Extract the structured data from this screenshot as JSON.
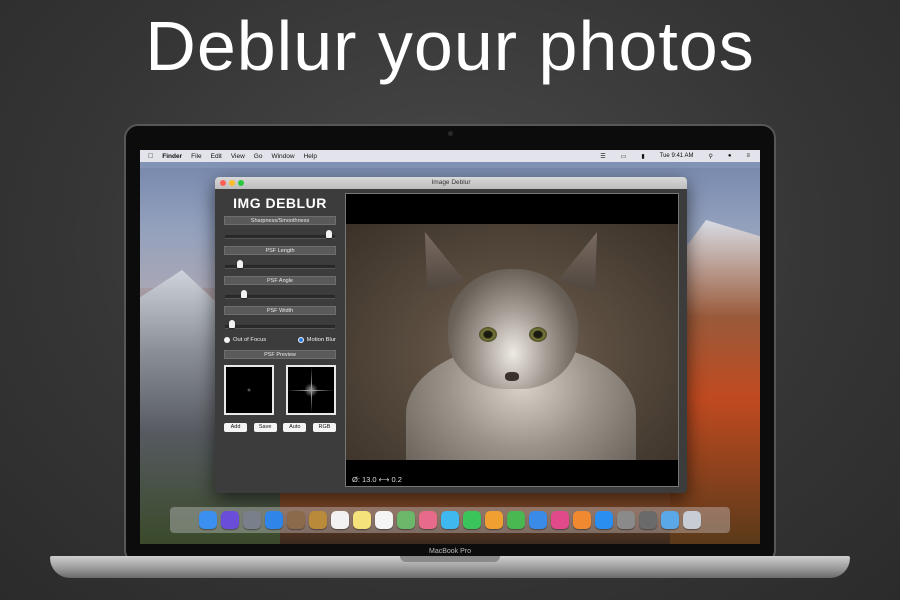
{
  "hero": {
    "title": "Deblur your photos"
  },
  "menubar": {
    "items": [
      "Finder",
      "File",
      "Edit",
      "View",
      "Go",
      "Window",
      "Help"
    ],
    "clock": "Tue 9:41 AM"
  },
  "window": {
    "title": "Image Deblur"
  },
  "panel": {
    "heading": "IMG DEBLUR",
    "sections": [
      {
        "label": "Sharpness/Smoothness",
        "value": 0.97
      },
      {
        "label": "PSF Length",
        "value": 0.12
      },
      {
        "label": "PSF Angle",
        "value": 0.15
      },
      {
        "label": "PSF Width",
        "value": 0.04
      }
    ],
    "radio_out_of_focus": "Out of Focus",
    "radio_motion_blur": "Motion Blur",
    "selected_mode": "Motion Blur",
    "psf_preview_label": "PSF Preview",
    "buttons": {
      "add": "Add",
      "save": "Save",
      "auto": "Auto",
      "rgb": "RGB"
    }
  },
  "viewer": {
    "caption": "Ø: 13.0 ⟷ 0.2"
  },
  "dock": {
    "icons": [
      "finder-icon",
      "siri-icon",
      "launchpad-icon",
      "safari-icon",
      "photos-preview-icon",
      "notes-brown-icon",
      "calendar-icon",
      "stickies-icon",
      "reminders-icon",
      "maps-icon",
      "photos-icon",
      "messages-icon",
      "facetime-icon",
      "pages-icon",
      "numbers-icon",
      "keynote-icon",
      "itunes-icon",
      "ibooks-icon",
      "appstore-icon",
      "preferences-icon",
      "image-deblur-icon",
      "folder-icon",
      "trash-icon"
    ],
    "colors": [
      "#3b8ff0",
      "#6a4dd8",
      "#7a7f8c",
      "#2f86e8",
      "#8a6a4a",
      "#b88a3a",
      "#f2f2f2",
      "#f5e27a",
      "#f4f4f4",
      "#6cb86a",
      "#e86a8a",
      "#3fb8f0",
      "#3bc45a",
      "#f0a030",
      "#4ab850",
      "#3a8ae8",
      "#e04a8a",
      "#f08a30",
      "#2a8ef0",
      "#8a8a8a",
      "#6a6a6a",
      "#5aa8e8",
      "#c8ccd4"
    ]
  },
  "laptop": {
    "brand": "MacBook Pro"
  },
  "colors": {
    "accent": "#2a7de1",
    "window_bg": "#3c3c3c"
  }
}
